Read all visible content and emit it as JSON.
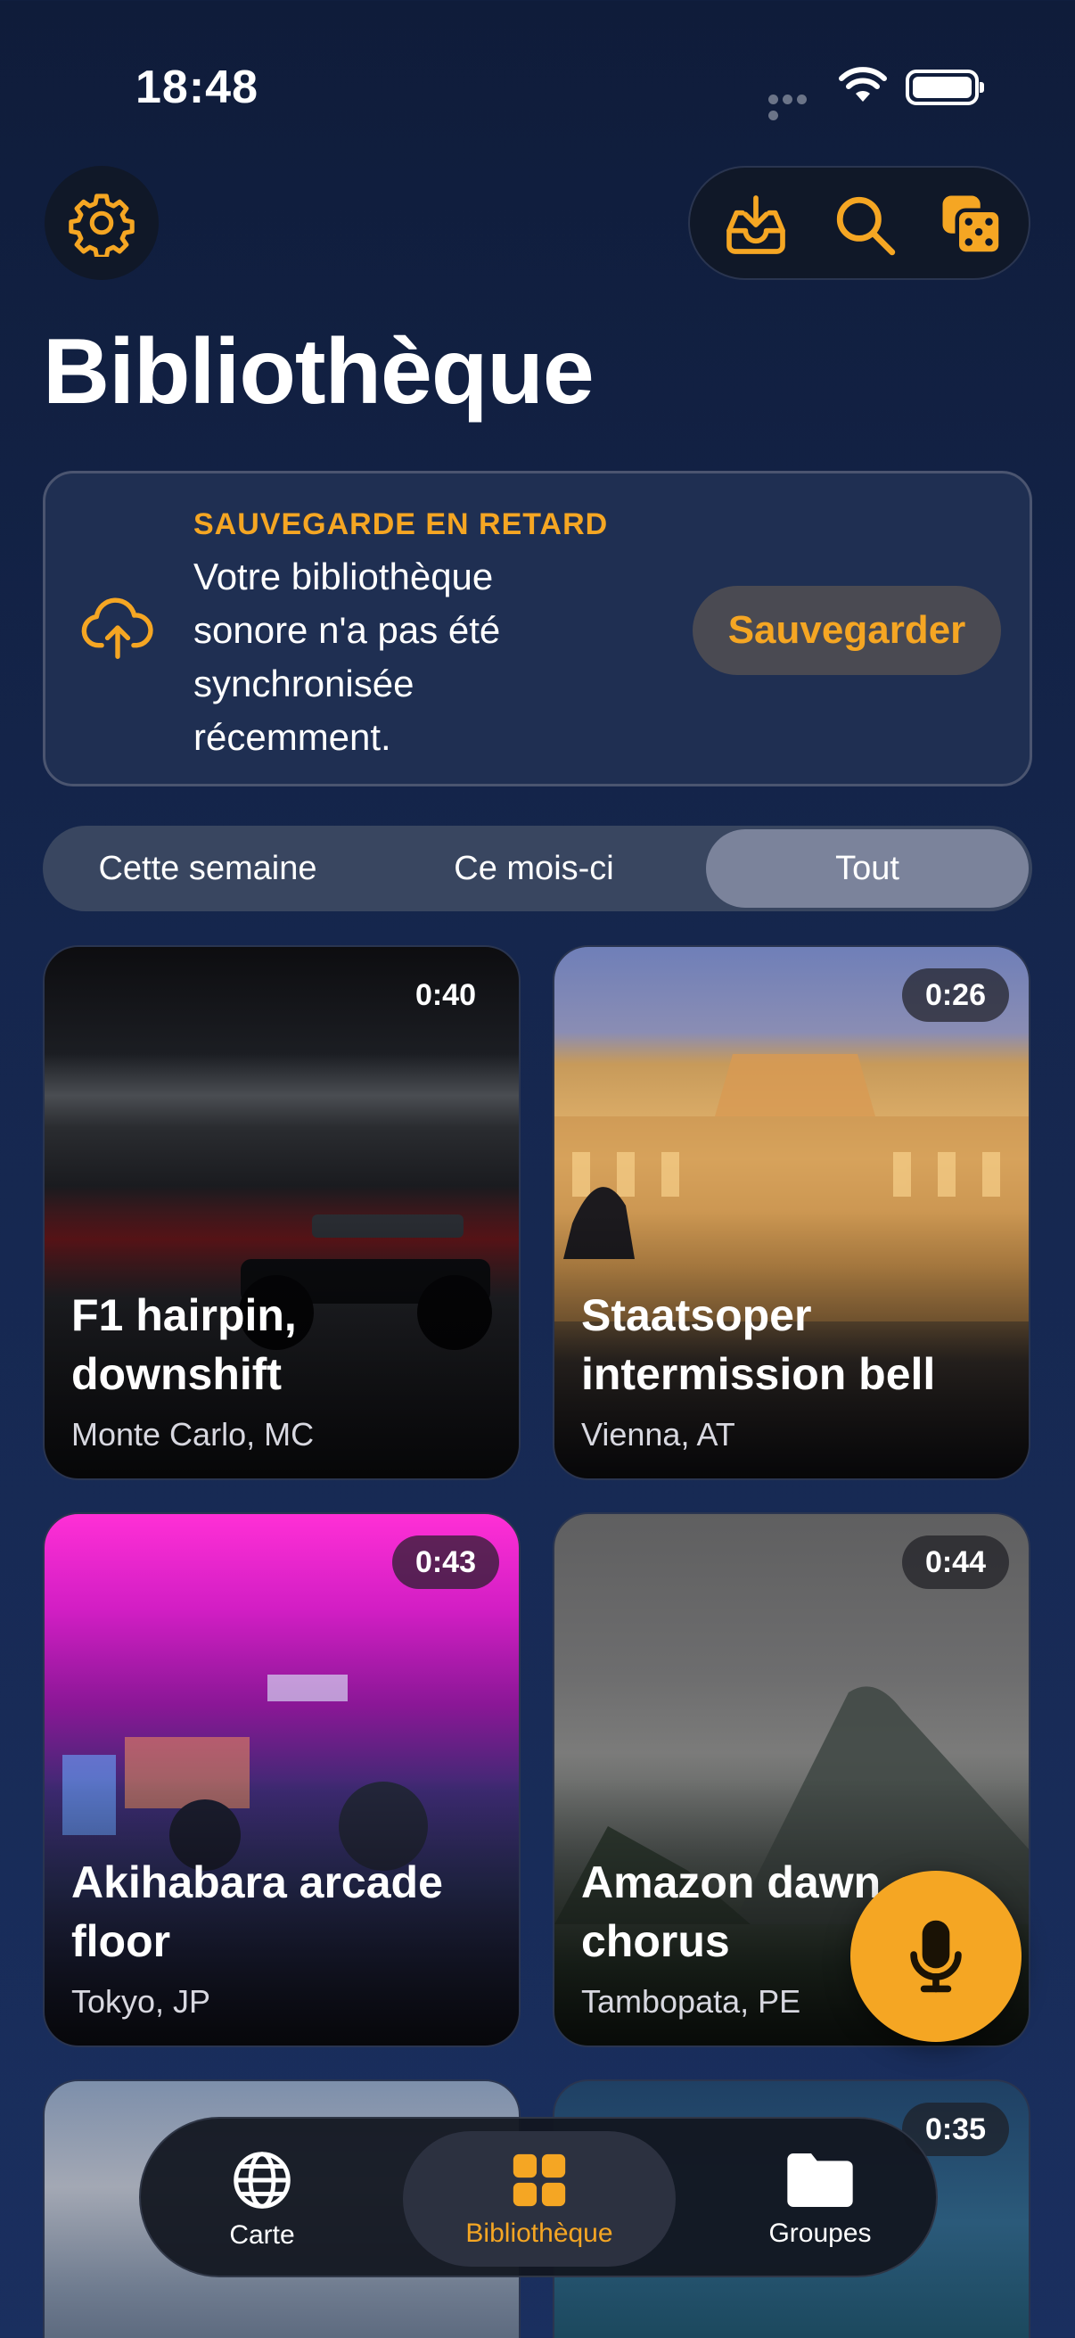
{
  "status_bar": {
    "time": "18:48"
  },
  "page": {
    "title": "Bibliothèque"
  },
  "toolbar": {
    "settings_icon": "gear-icon",
    "actions": [
      "inbox-download-icon",
      "search-icon",
      "dice-icon"
    ]
  },
  "banner": {
    "eyebrow": "SAUVEGARDE EN RETARD",
    "text": "Votre bibliothèque sonore n'a pas été synchronisée récemment.",
    "button": "Sauvegarder"
  },
  "filters": {
    "options": [
      "Cette semaine",
      "Ce mois-ci",
      "Tout"
    ],
    "selected": "Tout"
  },
  "cards": [
    {
      "title": "F1 hairpin, downshift",
      "location": "Monte Carlo, MC",
      "duration": "0:40"
    },
    {
      "title": "Staatsoper intermission bell",
      "location": "Vienna, AT",
      "duration": "0:26"
    },
    {
      "title": "Akihabara arcade floor",
      "location": "Tokyo, JP",
      "duration": "0:43"
    },
    {
      "title": "Amazon dawn chorus",
      "location": "Tambopata, PE",
      "duration": "0:44"
    },
    {
      "title": "",
      "location": "",
      "duration": ""
    },
    {
      "title": "",
      "location": "",
      "duration": "0:35"
    }
  ],
  "tabbar": {
    "tabs": [
      {
        "label": "Carte",
        "icon": "globe-icon"
      },
      {
        "label": "Bibliothèque",
        "icon": "grid-icon"
      },
      {
        "label": "Groupes",
        "icon": "folder-icon"
      }
    ],
    "selected": "Bibliothèque"
  },
  "colors": {
    "accent": "#f5a623",
    "background": "#15264d"
  }
}
